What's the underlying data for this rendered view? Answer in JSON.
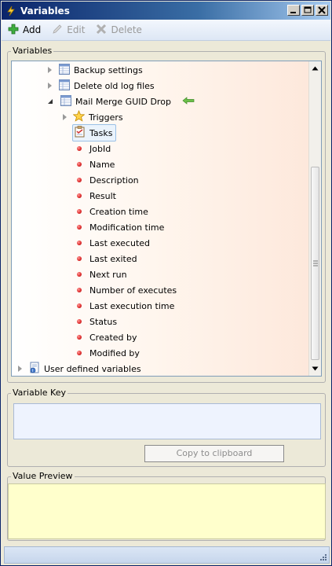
{
  "window": {
    "title": "Variables"
  },
  "toolbar": {
    "add_label": "Add",
    "edit_label": "Edit",
    "delete_label": "Delete"
  },
  "variables_group": {
    "legend": "Variables"
  },
  "tree": {
    "backup_settings": "Backup settings",
    "delete_old_log_files": "Delete old log files",
    "mail_merge_guid_drop": "Mail Merge GUID Drop",
    "triggers": "Triggers",
    "tasks": "Tasks",
    "fields": [
      "JobId",
      "Name",
      "Description",
      "Result",
      "Creation time",
      "Modification time",
      "Last executed",
      "Last exited",
      "Next run",
      "Number of executes",
      "Last execution time",
      "Status",
      "Created by",
      "Modified by"
    ],
    "user_defined_variables": "User defined variables"
  },
  "variable_key_group": {
    "legend": "Variable Key",
    "value": ""
  },
  "copy_button": {
    "label": "Copy to clipboard"
  },
  "value_preview_group": {
    "legend": "Value Preview",
    "value": ""
  },
  "colors": {
    "title_start": "#0a246a",
    "title_end": "#a6caf0",
    "preview_bg": "#ffffcc",
    "pointer_arrow": "#4caf50"
  }
}
